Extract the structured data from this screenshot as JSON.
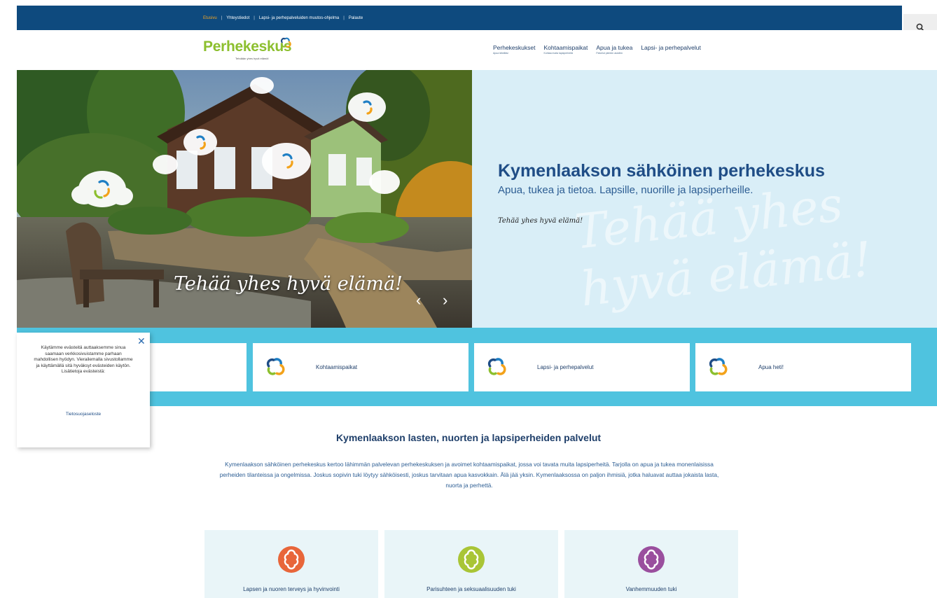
{
  "top_links": [
    {
      "label": "Etusivu",
      "active": true
    },
    {
      "label": "Yhteystiedot",
      "active": false
    },
    {
      "label": "Lapsi- ja perhepalveluiden muutos-ohjelma",
      "active": false
    },
    {
      "label": "Palaute",
      "active": false
    }
  ],
  "search": {
    "icon": "search-icon"
  },
  "logo": {
    "text": "Perhekeskus",
    "tagline": "Tehdään yhes hyvä elämä!"
  },
  "main_nav": [
    {
      "label": "Perhekeskukset",
      "sub": "Apua lähelläsi"
    },
    {
      "label": "Kohtaamispaikat",
      "sub": "Kohtaa muita lapsiperheitä"
    },
    {
      "label": "Apua ja tukea",
      "sub": "Palvelut pienten asioihin"
    },
    {
      "label": "Lapsi- ja perhepalvelut",
      "sub": ""
    }
  ],
  "hero": {
    "title": "Kymenlaakson sähköinen perhekeskus",
    "subtitle": "Apua, tukea ja tietoa. Lapsille, nuorille ja lapsiperheille.",
    "slogan": "Tehää yhes hyvä elämä!",
    "photo_caption": "Tehää yhes hyvä elämä!",
    "watermark": "Tehää yhes\nhyvä elämä!",
    "prev": "‹",
    "next": "›"
  },
  "quick_links": [
    {
      "label": "",
      "icon": "perhekeskus-logo-icon"
    },
    {
      "label": "Kohtaamispaikat",
      "icon": "perhekeskus-logo-icon"
    },
    {
      "label": "Lapsi- ja perhepalvelut",
      "icon": "perhekeskus-logo-icon"
    },
    {
      "label": "Apua heti!",
      "icon": "perhekeskus-logo-icon"
    }
  ],
  "cookie": {
    "text": "Käytämme evästeitä auttaaksemme sinua saamaan verkkosivuistamme parhaan mahdollisen hyödyn. Vierailemalla sivustollamme ja käyttämällä sitä hyväksyt evästeiden käytön. Lisätietoja evästeistä:",
    "link": "Tietosuojaseloste",
    "close": "✕"
  },
  "services": {
    "title": "Kymenlaakson lasten, nuorten ja lapsiperheiden palvelut",
    "text": "Kymenlaakson sähköinen perhekeskus kertoo lähimmän palvelevan perhekeskuksen ja avoimet kohtaamispaikat, jossa voi tavata muita lapsiperheitä. Tarjolla on apua ja tukea monenlaisissa perheiden tilanteissa ja ongelmissa. Joskus sopivin tuki löytyy sähköisesti, joskus tarvitaan apua kasvokkain. Älä jää yksin. Kymenlaaksossa on paljon ihmisiä, jotka haluavat auttaa jokaista lasta, nuorta ja perhettä.",
    "cards": [
      {
        "label": "Lapsen ja nuoren terveys ja hyvinvointi",
        "color": "#e8663a"
      },
      {
        "label": "Parisuhteen ja seksuaalisuuden tuki",
        "color": "#a9c536"
      },
      {
        "label": "Vanhemmuuden tuki",
        "color": "#9a4f9e"
      }
    ]
  },
  "colors": {
    "brand_navy": "#0e4a7e",
    "brand_green": "#8cbf2e",
    "band_cyan": "#4fc3df",
    "hero_bg": "#d9eef7"
  }
}
